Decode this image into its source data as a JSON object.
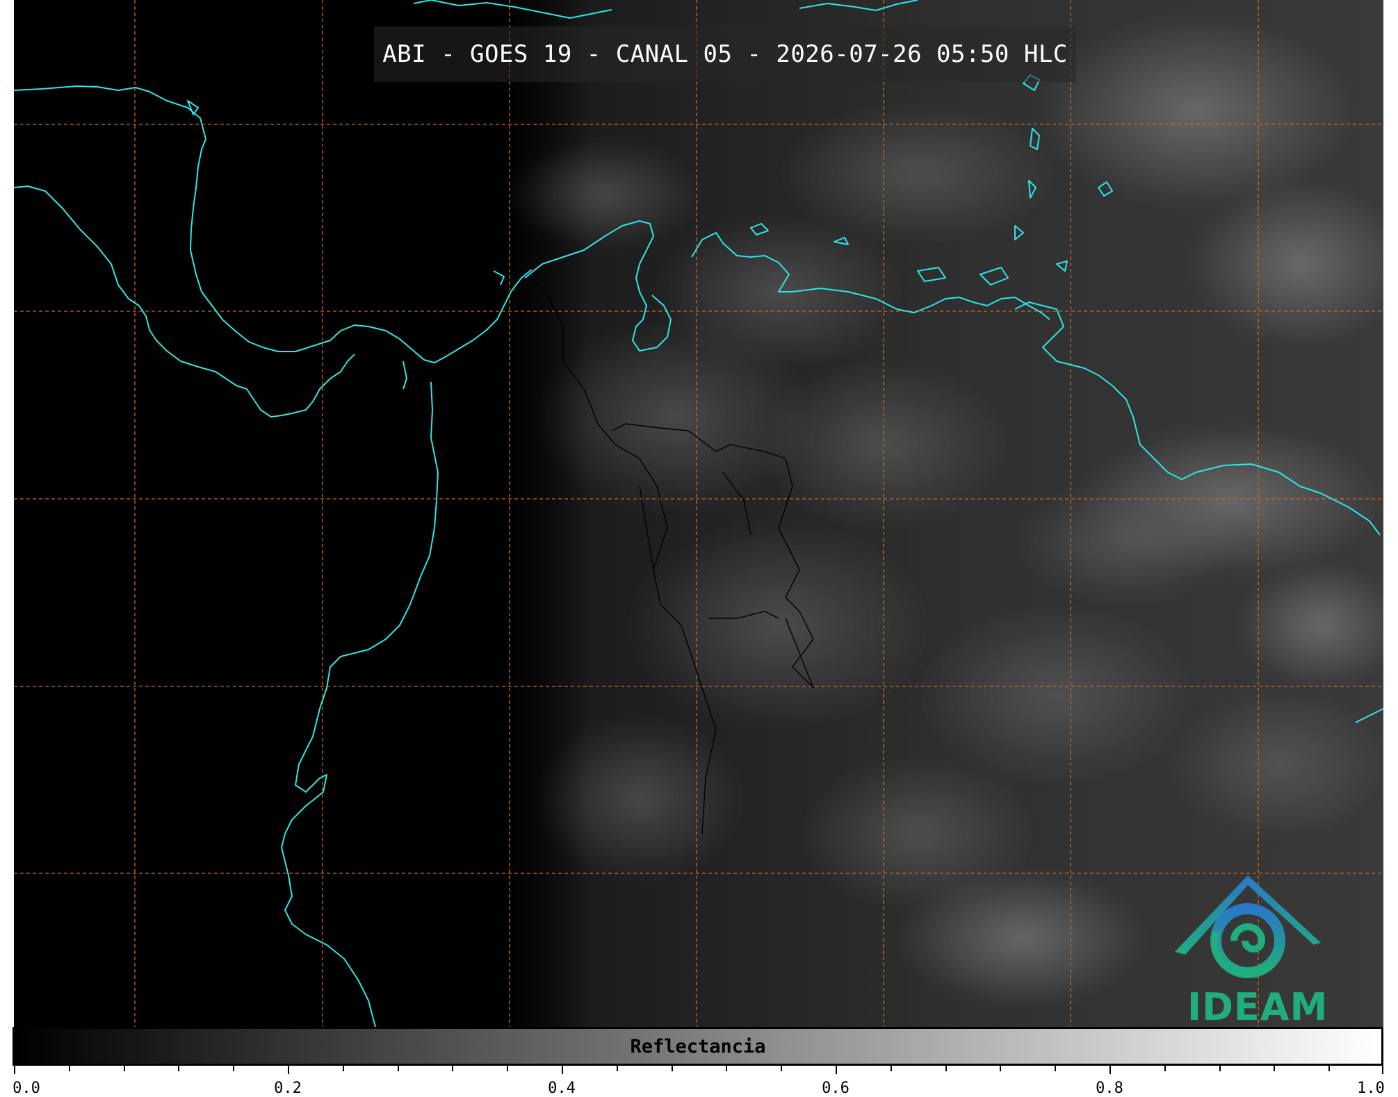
{
  "title": "ABI - GOES 19 - CANAL 05 - 2026-07-26 05:50 HLC",
  "logo": {
    "text": "IDEAM",
    "icon": "ideam-mountain-swirl-icon"
  },
  "colorbar": {
    "label": "Reflectancia",
    "range": [
      0.0,
      1.0
    ],
    "ticks": [
      "0.0",
      "0.2",
      "0.4",
      "0.6",
      "0.8",
      "1.0"
    ],
    "minor_ticks_per_interval": 4,
    "colormap": [
      "#000000",
      "#ffffff"
    ]
  },
  "colors": {
    "coastline": "#2ee6e6",
    "gridlines": "#d06a20",
    "borders": "#000000",
    "logo_blue": "#2a78c8",
    "logo_green": "#1fae7c"
  },
  "gridlines": {
    "style": "dashed"
  }
}
